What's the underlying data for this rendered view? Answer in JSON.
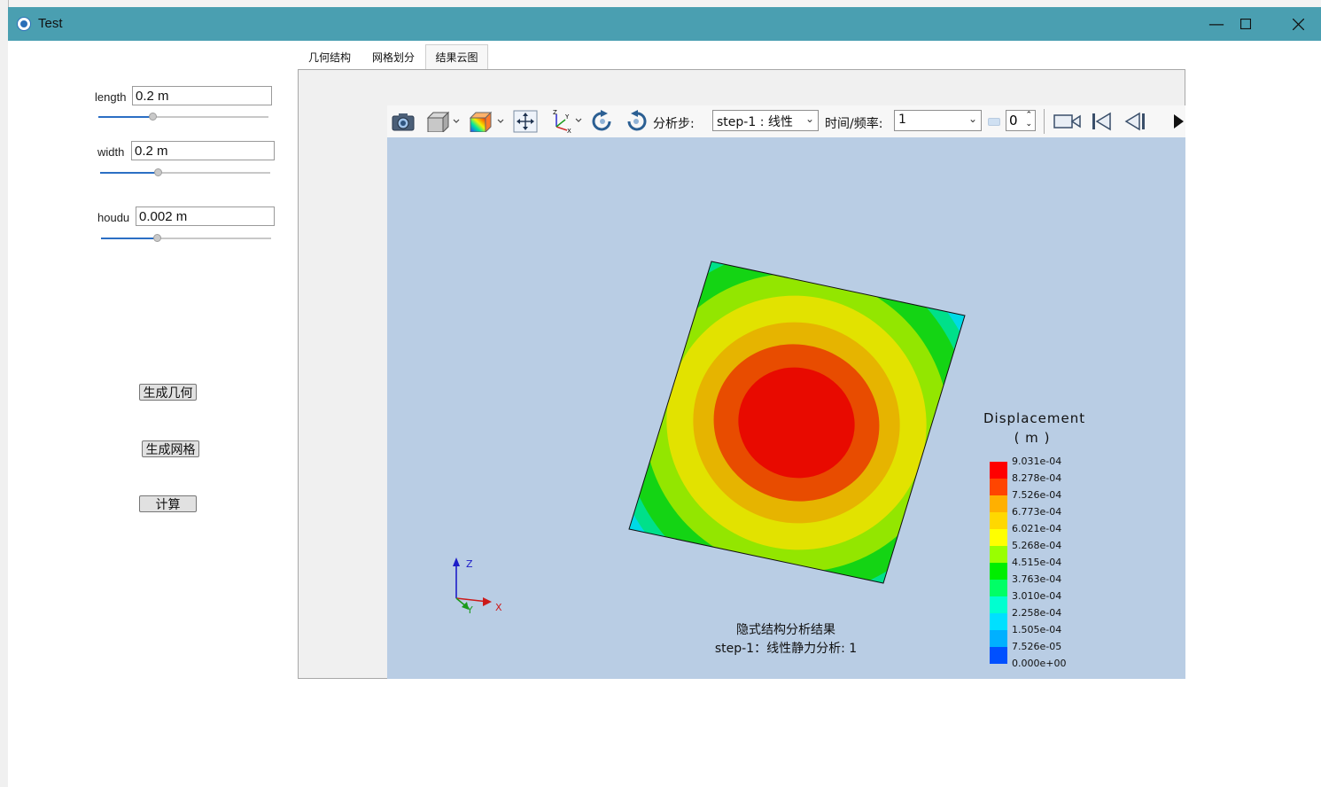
{
  "window": {
    "title": "Test",
    "minimize_icon": "minimize-icon",
    "maximize_icon": "maximize-icon",
    "close_icon": "close-icon"
  },
  "params": {
    "length": {
      "label": "length",
      "value": "0.2 m",
      "level": 0.32
    },
    "width": {
      "label": "width",
      "value": "0.2 m",
      "level": 0.34
    },
    "houdu": {
      "label": "houdu",
      "value": "0.002 m",
      "level": 0.33
    }
  },
  "buttons": {
    "gen_geometry": "生成几何",
    "gen_mesh": "生成网格",
    "compute": "计算"
  },
  "tabs": [
    {
      "label": "几何结构",
      "active": false
    },
    {
      "label": "网格划分",
      "active": false
    },
    {
      "label": "结果云图",
      "active": true
    }
  ],
  "toolbar": {
    "icons": [
      "camera-icon",
      "cube-view-icon",
      "color-map-icon",
      "pan-icon",
      "axes-icon",
      "rotate-cw-icon",
      "rotate-ccw-icon",
      "video-camera-icon",
      "first-frame-icon",
      "prev-frame-icon",
      "next-frame-icon"
    ],
    "step_label": "分析步:",
    "step_value": "step-1 : 线性",
    "time_label": "时间/频率:",
    "time_value": "1",
    "frame_value": "0"
  },
  "viewport": {
    "caption_line1": "隐式结构分析结果",
    "caption_line2": "step-1：线性静力分析: 1",
    "axis_labels": {
      "x": "X",
      "y": "Y",
      "z": "Z"
    }
  },
  "legend": {
    "title": "Displacement",
    "unit": "( m )",
    "labels": [
      "9.031e-04",
      "8.278e-04",
      "7.526e-04",
      "6.773e-04",
      "6.021e-04",
      "5.268e-04",
      "4.515e-04",
      "3.763e-04",
      "3.010e-04",
      "2.258e-04",
      "1.505e-04",
      "7.526e-05",
      "0.000e+00"
    ],
    "colors": [
      "#ff0000",
      "#ff4500",
      "#ffb000",
      "#ffd800",
      "#ffff00",
      "#99ff00",
      "#00ee00",
      "#00ff66",
      "#00ffd0",
      "#00e0ff",
      "#00b0ff",
      "#0050ff",
      "#0000ee"
    ]
  },
  "contour_colors": {
    "c0": "#0a1ad8",
    "c1": "#0b7cf0",
    "c2": "#00d9e6",
    "c3": "#00e08a",
    "c4": "#14d414",
    "c5": "#93e600",
    "c6": "#e2e200",
    "c7": "#e6b400",
    "c8": "#e84c00",
    "c9": "#e80a00"
  }
}
